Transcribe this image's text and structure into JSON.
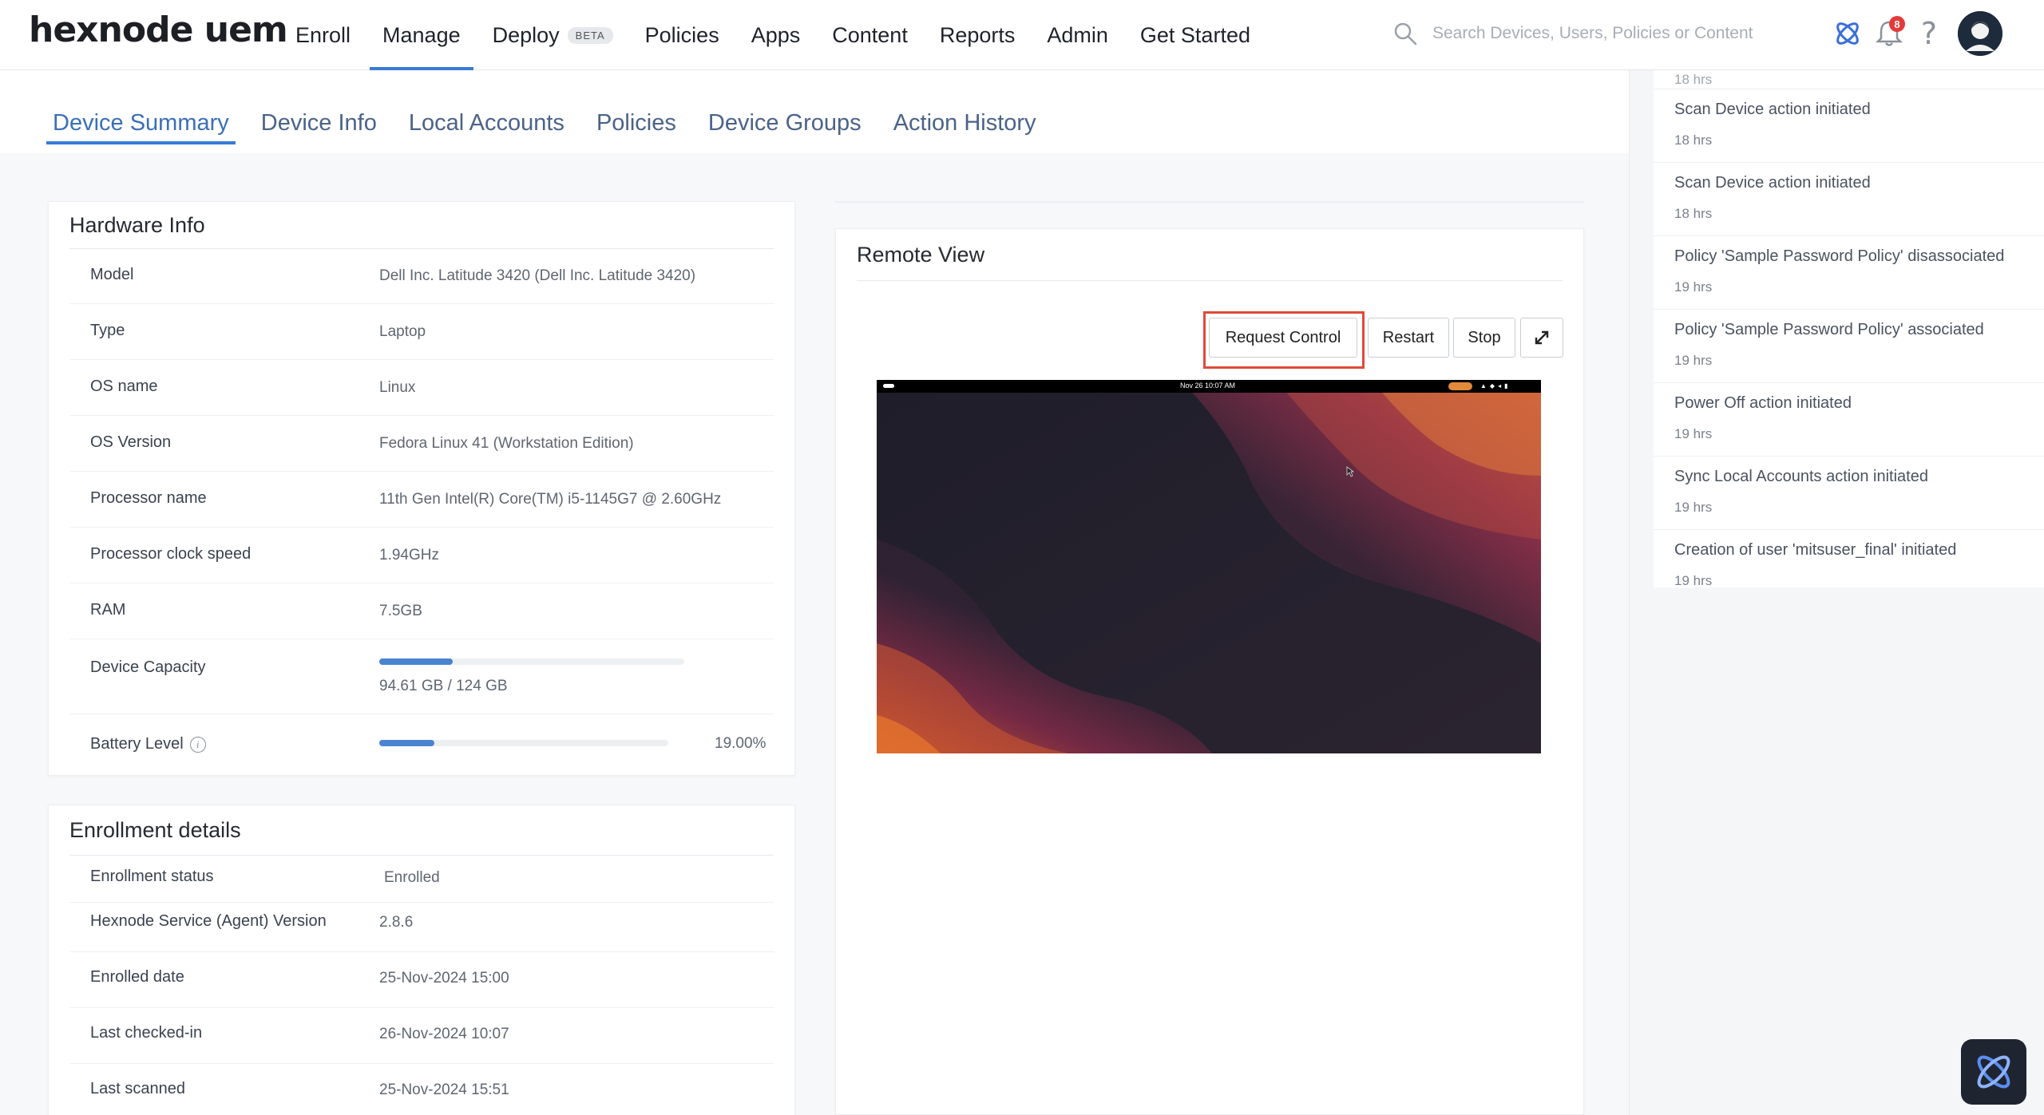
{
  "brand": {
    "logo_text": "hexnode uem"
  },
  "nav": {
    "items": [
      {
        "label": "Enroll"
      },
      {
        "label": "Manage"
      },
      {
        "label": "Deploy"
      },
      {
        "label": "Policies"
      },
      {
        "label": "Apps"
      },
      {
        "label": "Content"
      },
      {
        "label": "Reports"
      },
      {
        "label": "Admin"
      },
      {
        "label": "Get Started"
      }
    ],
    "active": "Manage",
    "deploy_badge": "BETA"
  },
  "search": {
    "placeholder": "Search Devices, Users, Policies or Content"
  },
  "notifications": {
    "count": "8"
  },
  "help": {
    "glyph": "?"
  },
  "tabs": [
    {
      "label": "Device Summary"
    },
    {
      "label": "Device Info"
    },
    {
      "label": "Local Accounts"
    },
    {
      "label": "Policies"
    },
    {
      "label": "Device Groups"
    },
    {
      "label": "Action History"
    }
  ],
  "hardware": {
    "title": "Hardware Info",
    "rows": [
      {
        "label": "Model",
        "value": "Dell Inc. Latitude 3420 (Dell Inc. Latitude 3420)"
      },
      {
        "label": "Type",
        "value": "Laptop"
      },
      {
        "label": "OS name",
        "value": "Linux"
      },
      {
        "label": "OS Version",
        "value": "Fedora Linux 41 (Workstation Edition)"
      },
      {
        "label": "Processor name",
        "value": "11th Gen Intel(R) Core(TM) i5-1145G7 @ 2.60GHz"
      },
      {
        "label": "Processor clock speed",
        "value": "1.94GHz"
      },
      {
        "label": "RAM",
        "value": "7.5GB"
      }
    ],
    "capacity": {
      "label": "Device Capacity",
      "value": "94.61 GB / 124 GB",
      "fill": 0.24
    },
    "battery": {
      "label": "Battery Level",
      "value": "19.00%",
      "fill": 0.19
    }
  },
  "enrollment": {
    "title": "Enrollment details",
    "rows": [
      {
        "label": "Enrollment status",
        "value": "Enrolled"
      },
      {
        "label": "Hexnode Service (Agent) Version",
        "value": "2.8.6"
      },
      {
        "label": "Enrolled date",
        "value": "25-Nov-2024 15:00"
      },
      {
        "label": "Last checked-in",
        "value": "26-Nov-2024 10:07"
      },
      {
        "label": "Last scanned",
        "value": "25-Nov-2024 15:51"
      }
    ]
  },
  "remote_view": {
    "title": "Remote View",
    "request_control": "Request Control",
    "restart": "Restart",
    "stop": "Stop",
    "screen_clock": "Nov 26  10:07 AM"
  },
  "activity": [
    {
      "title": "",
      "time": "18 hrs"
    },
    {
      "title": "Scan Device action initiated",
      "time": "18 hrs"
    },
    {
      "title": "Scan Device action initiated",
      "time": "18 hrs"
    },
    {
      "title": "Policy 'Sample Password Policy' disassociated",
      "time": "19 hrs"
    },
    {
      "title": "Policy 'Sample Password Policy' associated",
      "time": "19 hrs"
    },
    {
      "title": "Power Off action initiated",
      "time": "19 hrs"
    },
    {
      "title": "Sync Local Accounts action initiated",
      "time": "19 hrs"
    },
    {
      "title": "Creation of user 'mitsuser_final' initiated",
      "time": "19 hrs"
    }
  ],
  "colors": {
    "accent": "#3a7bd5",
    "highlight": "#e04a3a",
    "bar": "#4a84d1"
  }
}
